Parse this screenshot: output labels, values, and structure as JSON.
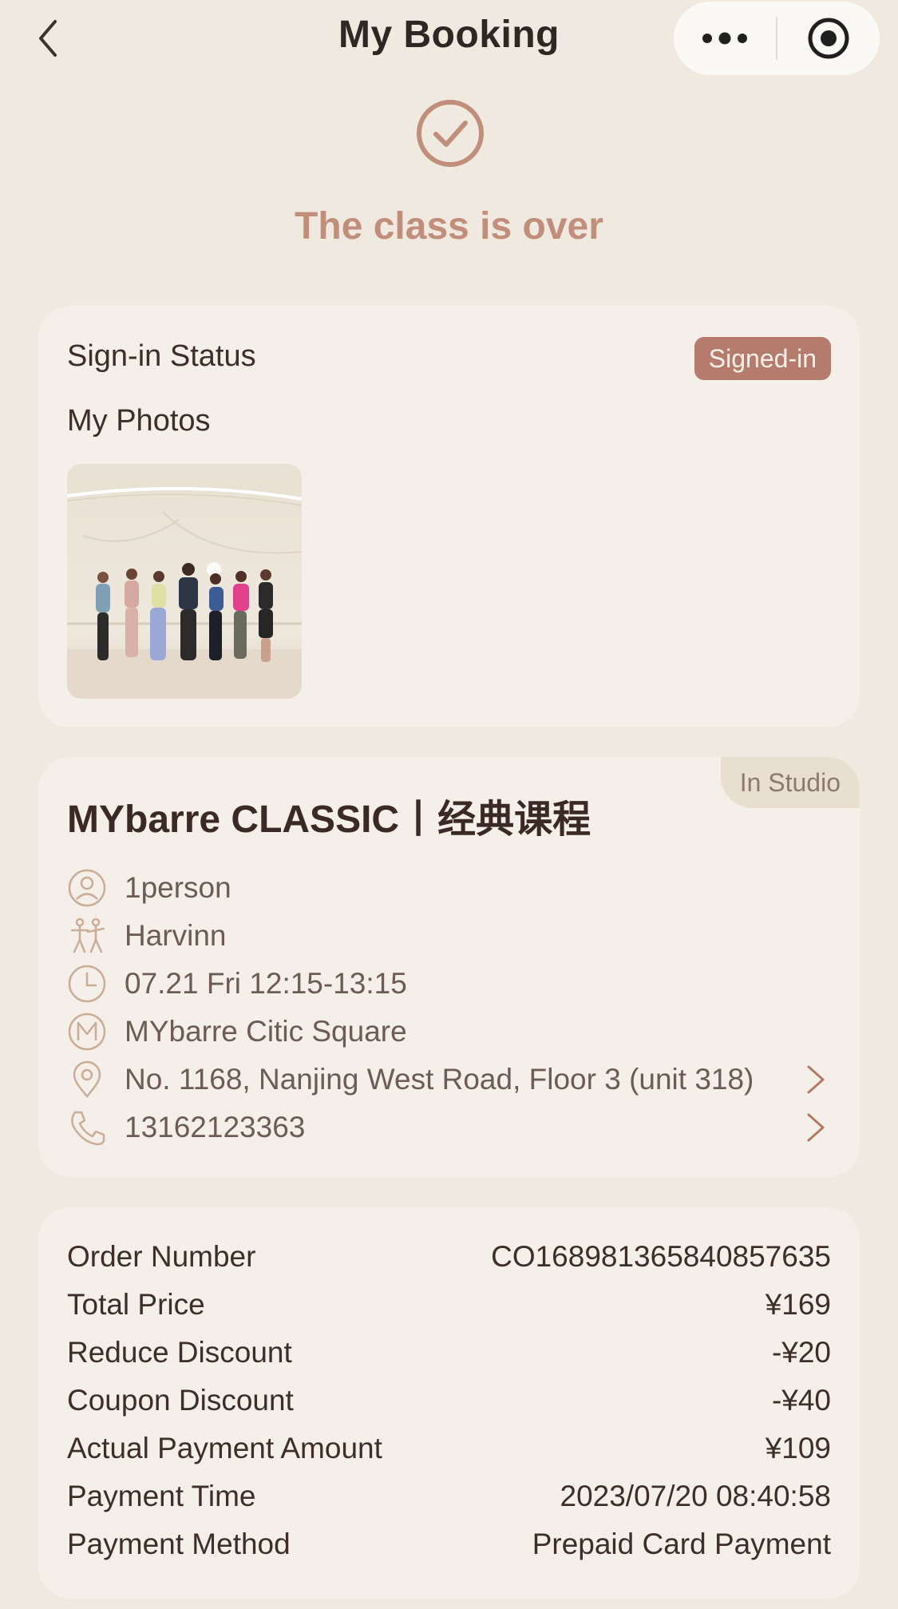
{
  "header": {
    "title": "My Booking"
  },
  "status": {
    "text": "The class is over"
  },
  "signin": {
    "label": "Sign-in Status",
    "badge": "Signed-in",
    "photos_label": "My Photos"
  },
  "class": {
    "tag": "In Studio",
    "title": "MYbarre CLASSIC丨经典课程",
    "people": "1person",
    "instructor": "Harvinn",
    "time": "07.21 Fri 12:15-13:15",
    "studio": "MYbarre Citic Square",
    "address": "No. 1168, Nanjing West Road, Floor 3 (unit 318)",
    "phone": "13162123363"
  },
  "order": {
    "rows": [
      {
        "label": "Order Number",
        "value": "CO1689813658408576​35"
      },
      {
        "label": "Total Price",
        "value": "¥169"
      },
      {
        "label": "Reduce Discount",
        "value": "-¥20"
      },
      {
        "label": "Coupon Discount",
        "value": "-¥40"
      },
      {
        "label": "Actual Payment Amount",
        "value": "¥109"
      },
      {
        "label": "Payment Time",
        "value": "2023/07/20 08:40:58"
      },
      {
        "label": "Payment Method",
        "value": "Prepaid Card Payment"
      }
    ]
  },
  "colors": {
    "accent": "#c08e7b",
    "badge": "#b57c6e",
    "background": "#efe9df",
    "card": "#f4efe8"
  }
}
